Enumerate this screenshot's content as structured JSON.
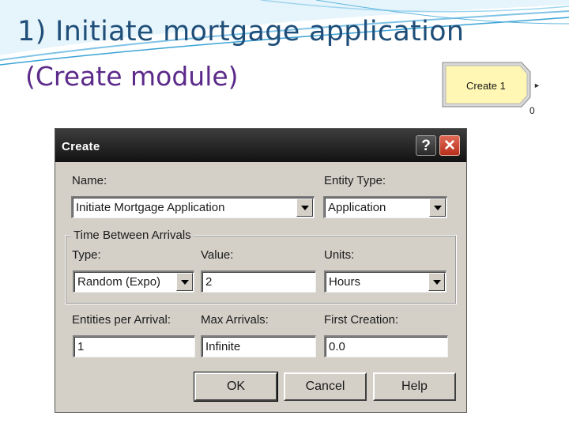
{
  "slide": {
    "title": "1) Initiate mortgage application",
    "subtitle": "(Create module)"
  },
  "module": {
    "label": "Create 1",
    "count": "0",
    "arrow_glyph": "►",
    "fill_color": "#fff7b3",
    "border_color": "#8a8a8a"
  },
  "dialog": {
    "title": "Create",
    "help_glyph": "?",
    "close_glyph": "✕",
    "name": {
      "label": "Name:",
      "value": "Initiate Mortgage Application"
    },
    "entity_type": {
      "label": "Entity Type:",
      "value": "Application"
    },
    "time_between_arrivals": {
      "group_label": "Time Between Arrivals",
      "type": {
        "label": "Type:",
        "value": "Random (Expo)"
      },
      "value": {
        "label": "Value:",
        "value": "2"
      },
      "units": {
        "label": "Units:",
        "value": "Hours"
      }
    },
    "entities_per_arrival": {
      "label": "Entities per Arrival:",
      "value": "1"
    },
    "max_arrivals": {
      "label": "Max Arrivals:",
      "value": "Infinite"
    },
    "first_creation": {
      "label": "First Creation:",
      "value": "0.0"
    },
    "buttons": {
      "ok": "OK",
      "cancel": "Cancel",
      "help": "Help"
    }
  },
  "colors": {
    "title_blue": "#1f4e79",
    "subtitle_purple": "#5b2a8a",
    "dialog_face": "#d4d0c8",
    "titlebar_dark": "#1e1e1e",
    "close_red": "#c8432d"
  }
}
